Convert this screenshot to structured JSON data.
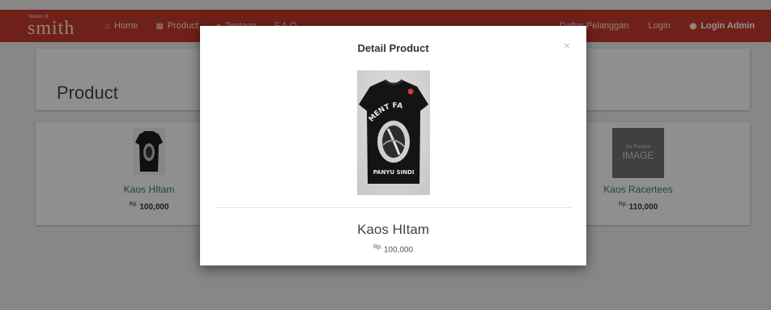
{
  "navbar": {
    "brand_tagline": "house of",
    "brand_name": "smith",
    "left_items": [
      {
        "label": "Home",
        "icon": "home-icon"
      },
      {
        "label": "Product",
        "icon": "grid-icon"
      },
      {
        "label": "Tentang",
        "icon": "info-icon"
      },
      {
        "label": "F.A.Q",
        "icon": ""
      }
    ],
    "right_items": [
      {
        "label": "Daftar Pelanggan"
      },
      {
        "label": "Login"
      },
      {
        "label": "Login Admin",
        "icon": "user-circle-icon"
      }
    ],
    "color": "#c0392b"
  },
  "page": {
    "title": "Product"
  },
  "products": [
    {
      "name": "Kaos HItam",
      "currency": "Rp.",
      "price": "100,000",
      "image": "black-tshirt"
    },
    {
      "name": "Kaos Racertees",
      "currency": "Rp.",
      "price": "110,000",
      "image": "no-preview",
      "no_preview_small": "No Preview",
      "no_preview_big": "IMAGE"
    }
  ],
  "modal": {
    "title": "Detail Product",
    "close": "×",
    "product_name": "Kaos HItam",
    "currency": "Rp.",
    "price": "100,000",
    "shirt_text_top": "MENT FA",
    "shirt_text_bottom": "PANYU SINDI"
  }
}
